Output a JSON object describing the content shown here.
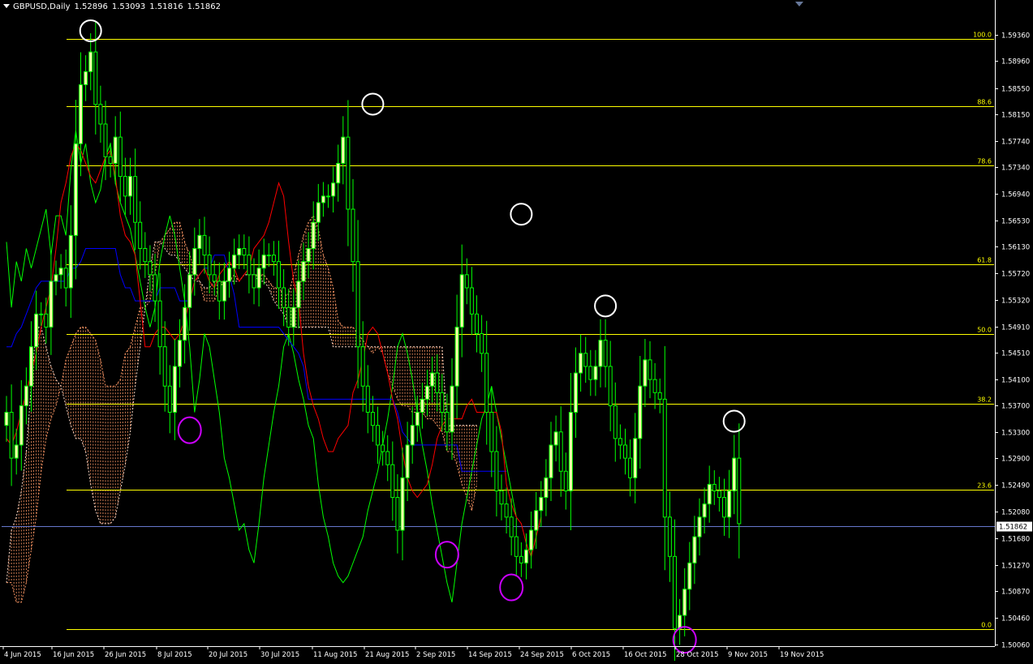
{
  "header": {
    "symbol": "GBPUSD,Daily",
    "open": "1.52896",
    "high": "1.53093",
    "low": "1.51816",
    "close": "1.51862"
  },
  "chart_data": {
    "type": "candlestick",
    "y_axis": {
      "range": [
        1.5003,
        1.5972
      ],
      "ticks": [
        "1.59360",
        "1.58960",
        "1.58550",
        "1.58150",
        "1.57740",
        "1.57340",
        "1.56940",
        "1.56530",
        "1.56130",
        "1.55720",
        "1.55320",
        "1.54910",
        "1.54510",
        "1.54100",
        "1.53700",
        "1.53300",
        "1.52900",
        "1.52490",
        "1.52080",
        "1.51680",
        "1.51270",
        "1.50870",
        "1.50460",
        "1.50060"
      ]
    },
    "x_axis": {
      "labels": [
        "4 Jun 2015",
        "16 Jun 2015",
        "26 Jun 2015",
        "8 Jul 2015",
        "20 Jul 2015",
        "30 Jul 2015",
        "11 Aug 2015",
        "21 Aug 2015",
        "2 Sep 2015",
        "14 Sep 2015",
        "24 Sep 2015",
        "6 Oct 2015",
        "16 Oct 2015",
        "28 Oct 2015",
        "9 Nov 2015",
        "19 Nov 2015"
      ]
    },
    "current_price": "1.51862",
    "fibonacci": {
      "high": 1.593,
      "low": 1.5029,
      "levels": [
        {
          "label": "100.0",
          "ratio": 1.0
        },
        {
          "label": "88.6",
          "ratio": 0.886
        },
        {
          "label": "78.6",
          "ratio": 0.786
        },
        {
          "label": "61.8",
          "ratio": 0.618
        },
        {
          "label": "50.0",
          "ratio": 0.5
        },
        {
          "label": "38.2",
          "ratio": 0.382
        },
        {
          "label": "23.6",
          "ratio": 0.236
        },
        {
          "label": "0.0",
          "ratio": 0.0
        }
      ]
    },
    "closes": [
      1.536,
      1.529,
      1.531,
      1.537,
      1.54,
      1.546,
      1.551,
      1.551,
      1.549,
      1.556,
      1.557,
      1.558,
      1.555,
      1.563,
      1.577,
      1.586,
      1.588,
      1.591,
      1.583,
      1.58,
      1.575,
      1.574,
      1.578,
      1.572,
      1.569,
      1.572,
      1.565,
      1.561,
      1.559,
      1.557,
      1.553,
      1.546,
      1.54,
      1.536,
      1.543,
      1.547,
      1.552,
      1.557,
      1.561,
      1.563,
      1.56,
      1.557,
      1.556,
      1.553,
      1.556,
      1.558,
      1.56,
      1.561,
      1.56,
      1.557,
      1.555,
      1.558,
      1.56,
      1.56,
      1.559,
      1.555,
      1.552,
      1.549,
      1.552,
      1.556,
      1.559,
      1.561,
      1.565,
      1.568,
      1.569,
      1.569,
      1.571,
      1.574,
      1.578,
      1.567,
      1.559,
      1.546,
      1.54,
      1.536,
      1.534,
      1.531,
      1.53,
      1.528,
      1.523,
      1.518,
      1.526,
      1.531,
      1.534,
      1.536,
      1.538,
      1.54,
      1.542,
      1.539,
      1.536,
      1.533,
      1.54,
      1.549,
      1.557,
      1.555,
      1.551,
      1.548,
      1.545,
      1.536,
      1.53,
      1.524,
      1.522,
      1.52,
      1.517,
      1.514,
      1.513,
      1.515,
      1.518,
      1.521,
      1.523,
      1.526,
      1.531,
      1.533,
      1.527,
      1.524,
      1.536,
      1.542,
      1.545,
      1.543,
      1.541,
      1.543,
      1.547,
      1.543,
      1.537,
      1.532,
      1.531,
      1.529,
      1.526,
      1.532,
      1.54,
      1.544,
      1.541,
      1.539,
      1.538,
      1.52,
      1.514,
      1.503,
      1.505,
      1.509,
      1.513,
      1.517,
      1.52,
      1.522,
      1.525,
      1.524,
      1.523,
      1.52,
      1.524,
      1.529,
      1.519
    ],
    "tenkan": [
      1.532,
      1.531,
      1.533,
      1.536,
      1.539,
      1.542,
      1.545,
      1.549,
      1.552,
      1.555,
      1.561,
      1.568,
      1.571,
      1.575,
      1.577,
      1.576,
      1.574,
      1.572,
      1.571,
      1.573,
      1.575,
      1.576,
      1.572,
      1.566,
      1.563,
      1.562,
      1.56,
      1.553,
      1.546,
      1.546,
      1.548,
      1.549,
      1.549,
      1.548,
      1.547,
      1.548,
      1.55,
      1.553,
      1.556,
      1.557,
      1.558,
      1.556,
      1.555,
      1.557,
      1.558,
      1.559,
      1.558,
      1.556,
      1.557,
      1.558,
      1.561,
      1.562,
      1.563,
      1.565,
      1.568,
      1.571,
      1.569,
      1.562,
      1.556,
      1.553,
      1.545,
      1.54,
      1.537,
      1.535,
      1.532,
      1.53,
      1.53,
      1.532,
      1.533,
      1.534,
      1.539,
      1.541,
      1.544,
      1.548,
      1.549,
      1.548,
      1.545,
      1.542,
      1.538,
      1.535,
      1.53,
      1.526,
      1.524,
      1.523,
      1.524,
      1.525,
      1.528,
      1.532,
      1.534,
      1.535,
      1.535,
      1.535,
      1.535,
      1.537,
      1.538,
      1.536,
      1.536,
      1.536,
      1.536,
      1.536,
      1.533,
      1.525,
      1.522,
      1.52,
      1.519,
      1.516,
      1.514,
      1.517,
      1.52
    ],
    "kijun": [
      1.546,
      1.546,
      1.548,
      1.549,
      1.551,
      1.553,
      1.555,
      1.556,
      1.556,
      1.556,
      1.556,
      1.556,
      1.556,
      1.558,
      1.558,
      1.559,
      1.561,
      1.561,
      1.561,
      1.561,
      1.561,
      1.561,
      1.561,
      1.557,
      1.555,
      1.555,
      1.553,
      1.553,
      1.553,
      1.553,
      1.553,
      1.555,
      1.555,
      1.555,
      1.555,
      1.553,
      1.553,
      1.553,
      1.556,
      1.557,
      1.558,
      1.558,
      1.56,
      1.56,
      1.56,
      1.557,
      1.554,
      1.549,
      1.549,
      1.549,
      1.549,
      1.549,
      1.549,
      1.549,
      1.549,
      1.549,
      1.548,
      1.547,
      1.546,
      1.545,
      1.543,
      1.538,
      1.538,
      1.538,
      1.538,
      1.538,
      1.538,
      1.538,
      1.538,
      1.538,
      1.538,
      1.538,
      1.538,
      1.538,
      1.538,
      1.538,
      1.538,
      1.538,
      1.538,
      1.536,
      1.533,
      1.532,
      1.531,
      1.531,
      1.531,
      1.531,
      1.531,
      1.531,
      1.531,
      1.531,
      1.531,
      1.531,
      1.527,
      1.527,
      1.527,
      1.527,
      1.527,
      1.527,
      1.527,
      1.527,
      1.527,
      1.527
    ],
    "senkou_a": [
      1.51,
      1.51,
      1.507,
      1.507,
      1.51,
      1.515,
      1.52,
      1.527,
      1.532,
      1.535,
      1.537,
      1.54,
      1.544,
      1.546,
      1.548,
      1.549,
      1.549,
      1.548,
      1.547,
      1.544,
      1.54,
      1.54,
      1.54,
      1.541,
      1.545,
      1.546,
      1.549,
      1.552,
      1.552,
      1.553,
      1.557,
      1.562,
      1.563,
      1.564,
      1.565,
      1.565,
      1.562,
      1.56,
      1.558,
      1.556,
      1.553,
      1.553,
      1.553,
      1.555,
      1.556,
      1.556,
      1.557,
      1.556,
      1.557,
      1.557,
      1.557,
      1.557,
      1.557,
      1.556,
      1.555,
      1.555,
      1.554,
      1.554,
      1.557,
      1.56,
      1.563,
      1.565,
      1.566,
      1.564,
      1.56,
      1.558,
      1.555,
      1.55,
      1.549,
      1.549,
      1.549,
      1.548,
      1.547,
      1.546,
      1.545,
      1.546,
      1.545,
      1.542,
      1.54,
      1.538,
      1.537,
      1.537,
      1.536,
      1.536,
      1.536,
      1.535,
      1.535,
      1.534,
      1.533,
      1.53,
      1.53,
      1.528,
      1.525,
      1.523,
      1.521,
      1.525
    ],
    "senkou_b": [
      1.51,
      1.518,
      1.52,
      1.524,
      1.53,
      1.54,
      1.549,
      1.549,
      1.546,
      1.543,
      1.541,
      1.54,
      1.537,
      1.534,
      1.532,
      1.532,
      1.53,
      1.525,
      1.521,
      1.519,
      1.519,
      1.519,
      1.52,
      1.524,
      1.528,
      1.533,
      1.54,
      1.546,
      1.552,
      1.558,
      1.562,
      1.562,
      1.561,
      1.56,
      1.56,
      1.559,
      1.558,
      1.557,
      1.556,
      1.556,
      1.555,
      1.555,
      1.556,
      1.556,
      1.556,
      1.556,
      1.556,
      1.556,
      1.557,
      1.557,
      1.557,
      1.556,
      1.556,
      1.555,
      1.553,
      1.552,
      1.551,
      1.549,
      1.549,
      1.549,
      1.549,
      1.549,
      1.549,
      1.549,
      1.549,
      1.549,
      1.546,
      1.546,
      1.546,
      1.546,
      1.546,
      1.546,
      1.546,
      1.546,
      1.546,
      1.546,
      1.546,
      1.546,
      1.546,
      1.546,
      1.546,
      1.546,
      1.546,
      1.546,
      1.546,
      1.546,
      1.546,
      1.546,
      1.546,
      1.534,
      1.534,
      1.534,
      1.534,
      1.534,
      1.534,
      1.534
    ],
    "chikou": [
      1.562,
      1.552,
      1.559,
      1.556,
      1.561,
      1.558,
      1.561,
      1.564,
      1.567,
      1.56,
      1.566,
      1.566,
      1.563,
      1.573,
      1.579,
      1.574,
      1.577,
      1.571,
      1.568,
      1.57,
      1.575,
      1.577,
      1.571,
      1.568,
      1.566,
      1.564,
      1.56,
      1.556,
      1.552,
      1.549,
      1.552,
      1.559,
      1.563,
      1.566,
      1.563,
      1.558,
      1.553,
      1.546,
      1.536,
      1.541,
      1.548,
      1.546,
      1.541,
      1.536,
      1.529,
      1.526,
      1.522,
      1.518,
      1.519,
      1.515,
      1.513,
      1.519,
      1.526,
      1.531,
      1.536,
      1.54,
      1.546,
      1.548,
      1.545,
      1.541,
      1.538,
      1.534,
      1.532,
      1.525,
      1.52,
      1.517,
      1.513,
      1.511,
      1.51,
      1.511,
      1.513,
      1.515,
      1.517,
      1.521,
      1.524,
      1.527,
      1.531,
      1.535,
      1.54,
      1.546,
      1.548,
      1.545,
      1.541,
      1.536,
      1.531,
      1.527,
      1.522,
      1.518,
      1.514,
      1.51,
      1.507,
      1.513,
      1.519,
      1.523,
      1.527,
      1.531,
      1.535,
      1.537,
      1.54,
      1.536,
      1.532,
      1.528,
      1.524,
      1.52
    ],
    "swing_marks": [
      {
        "type": "high",
        "index": 17,
        "price": 1.593
      },
      {
        "type": "high",
        "index": 74,
        "price": 1.5818
      },
      {
        "type": "high",
        "index": 104,
        "price": 1.565
      },
      {
        "type": "high",
        "index": 121,
        "price": 1.551
      },
      {
        "type": "high",
        "index": 147,
        "price": 1.5334
      },
      {
        "type": "low",
        "index": 37,
        "price": 1.535
      },
      {
        "type": "low",
        "index": 89,
        "price": 1.516
      },
      {
        "type": "low",
        "index": 102,
        "price": 1.511
      },
      {
        "type": "low",
        "index": 137,
        "price": 1.503
      }
    ]
  },
  "colors": {
    "background": "#000000",
    "bull_candle": "#ffffaa",
    "bear_candle": "#000000",
    "wick": "#00ff00",
    "tenkan": "#ff0000",
    "kijun": "#0000ff",
    "chikou": "#00ff00",
    "cloud": "#ff9966",
    "fib": "#ffff00",
    "swing_high_marker": "#ffffff",
    "swing_low_marker": "#cc00ff",
    "price_line": "#6677cc"
  }
}
